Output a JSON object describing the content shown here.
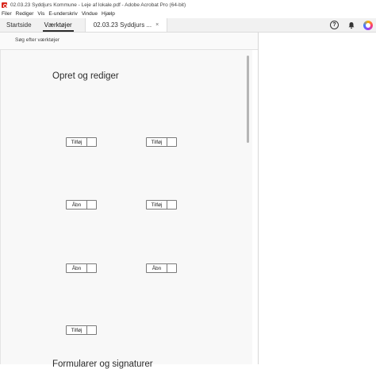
{
  "window": {
    "title": "02.03.23 Syddjurs Kommune - Leje af lokale.pdf - Adobe Acrobat Pro (64-bit)"
  },
  "menu": [
    "Filer",
    "Rediger",
    "Vis",
    "E-underskriv",
    "Vindue",
    "Hjælp"
  ],
  "tabs": {
    "home": "Startside",
    "tools": "Værktøjer",
    "document": "02.03.23 Syddjurs ...",
    "close_symbol": "×"
  },
  "toolbar_icons": [
    "help-icon",
    "bell-icon",
    "avatar"
  ],
  "tools_panel": {
    "search_label": "Søg efter værktøjer",
    "section_title": "Opret og rediger",
    "section_title_2": "Formularer og signaturer",
    "buttons": [
      {
        "label": "Tilføj"
      },
      {
        "label": "Tilføj"
      },
      {
        "label": "Åbn"
      },
      {
        "label": "Tilføj"
      },
      {
        "label": "Åbn"
      },
      {
        "label": "Åbn"
      },
      {
        "label": "Tilføj"
      }
    ]
  },
  "colors": {
    "acrobat_red": "#d9261c",
    "tab_active_underline": "#2c2c2c"
  }
}
